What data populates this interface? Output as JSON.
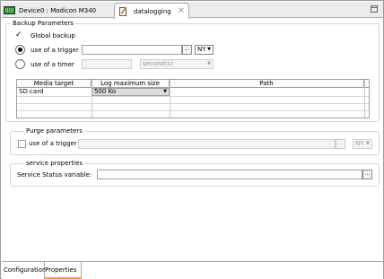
{
  "tabs": {
    "device": "Device0 : Modicon M340",
    "active": "datalogging"
  },
  "backup": {
    "title": "Backup Parameters",
    "global_backup": "Global backup",
    "use_trigger": "use of a trigger",
    "trigger_combo": "NY",
    "use_timer": "use of a timer",
    "timer_unit": "second(s)"
  },
  "table": {
    "headers": [
      "Media target",
      "Log maximum size",
      "Path"
    ],
    "rows": [
      {
        "media": "SD card",
        "size": "500 Ko",
        "path": ""
      }
    ]
  },
  "purge": {
    "title": "Purge parameters",
    "use_trigger": "use of a trigger",
    "trigger_combo": "NY"
  },
  "service": {
    "title": "service properties",
    "status_label": "Service Status variable:"
  },
  "bottom_tabs": [
    "Configuration",
    "Properties"
  ],
  "browse_label": "..."
}
